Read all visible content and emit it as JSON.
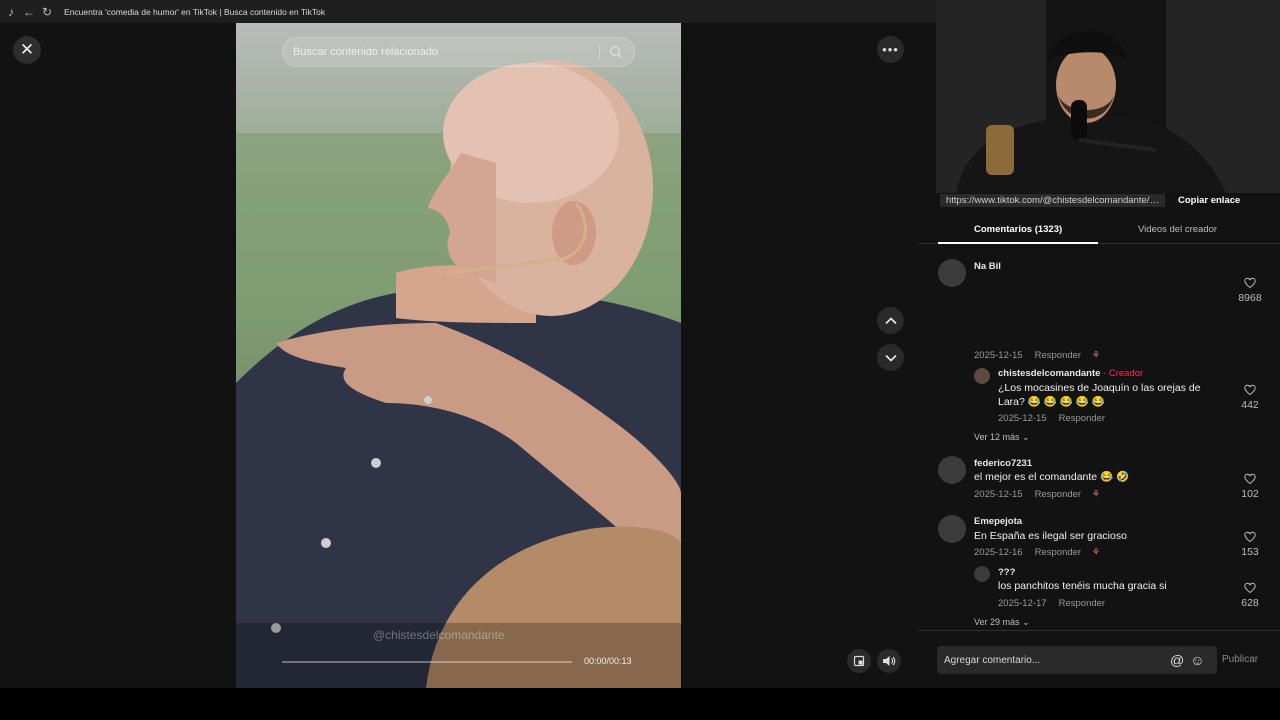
{
  "browser": {
    "title": "Encuentra 'comedia de humor' en TikTok | Busca contenido en TikTok"
  },
  "video": {
    "search_placeholder": "Buscar contenido relacionado",
    "watermark": "@chistesdelcomandante",
    "time": "00:00/00:13",
    "progress": 0
  },
  "panel": {
    "url": "https://www.tiktok.com/@chistesdelcomandante/video",
    "copy_link": "Copiar enlace",
    "tabs": [
      {
        "label": "Comentarios (1323)",
        "active": true
      },
      {
        "label": "Videos del creador",
        "active": false
      }
    ],
    "reply_label": "Responder",
    "comments": [
      {
        "user": "Na Bil",
        "likes": "8968",
        "date": "2025-12-15"
      },
      {
        "user": "chistesdelcomandante",
        "creator_tag": " · Creador",
        "text": "¿Los mocasines de Joaquín o las orejas de Lara? 😂 😂 😂 😂 😂",
        "date": "2025-12-15",
        "likes": "442"
      },
      {
        "more": "Ver 12 más"
      },
      {
        "user": "federico7231",
        "text": "el mejor es el comandante 😂 🤣",
        "date": "2025-12-15",
        "likes": "102"
      },
      {
        "user": "Emepejota",
        "text": "En España es ilegal ser gracioso",
        "date": "2025-12-16",
        "likes": "153"
      },
      {
        "user": "???",
        "text": "los panchitos tenéis mucha gracia si",
        "date": "2025-12-17",
        "likes": "628"
      },
      {
        "more": "Ver 29 más"
      }
    ],
    "comment_placeholder": "Agregar comentario...",
    "publish": "Publicar"
  }
}
